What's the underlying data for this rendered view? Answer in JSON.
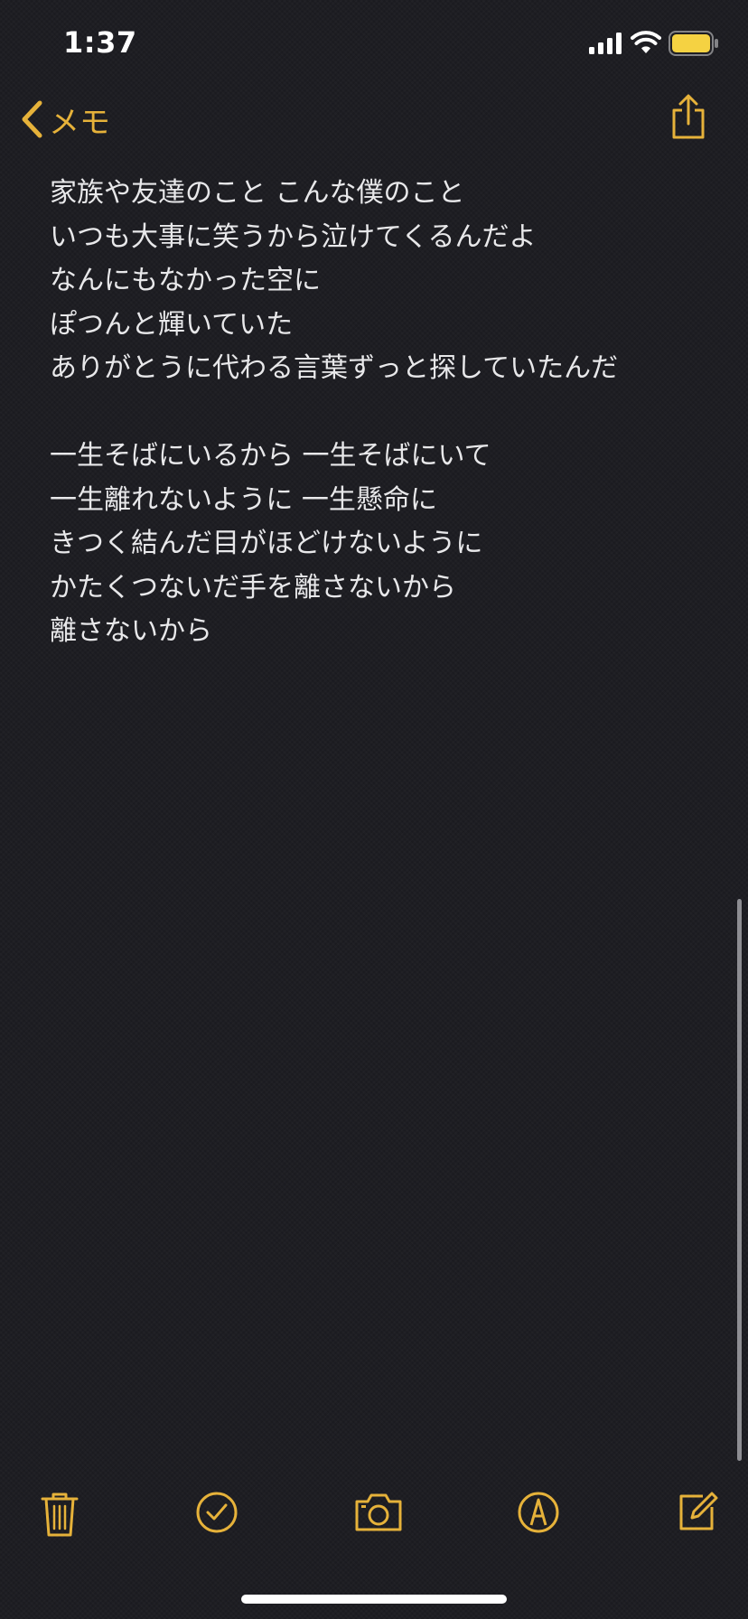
{
  "status_bar": {
    "time": "1:37",
    "icons": [
      "cellular-signal-icon",
      "wifi-icon",
      "battery-icon"
    ]
  },
  "nav": {
    "back_label": "メモ",
    "back_icon": "chevron-left-icon",
    "share_icon": "share-icon"
  },
  "note": {
    "lines": [
      "家族や友達のこと こんな僕のこと",
      "いつも大事に笑うから泣けてくるんだよ",
      "なんにもなかった空に",
      "ぽつんと輝いていた",
      "ありがとうに代わる言葉ずっと探していたんだ",
      "",
      "一生そばにいるから 一生そばにいて",
      "一生離れないように 一生懸命に",
      "きつく結んだ目がほどけないように",
      "かたくつないだ手を離さないから",
      "離さないから"
    ]
  },
  "toolbar": {
    "icons": [
      "trash-icon",
      "checklist-icon",
      "camera-icon",
      "markup-icon",
      "compose-icon"
    ]
  },
  "colors": {
    "accent": "#e6b23a",
    "background": "#1c1c21",
    "text": "#e8e8ea",
    "battery_fill": "#f5d242"
  }
}
